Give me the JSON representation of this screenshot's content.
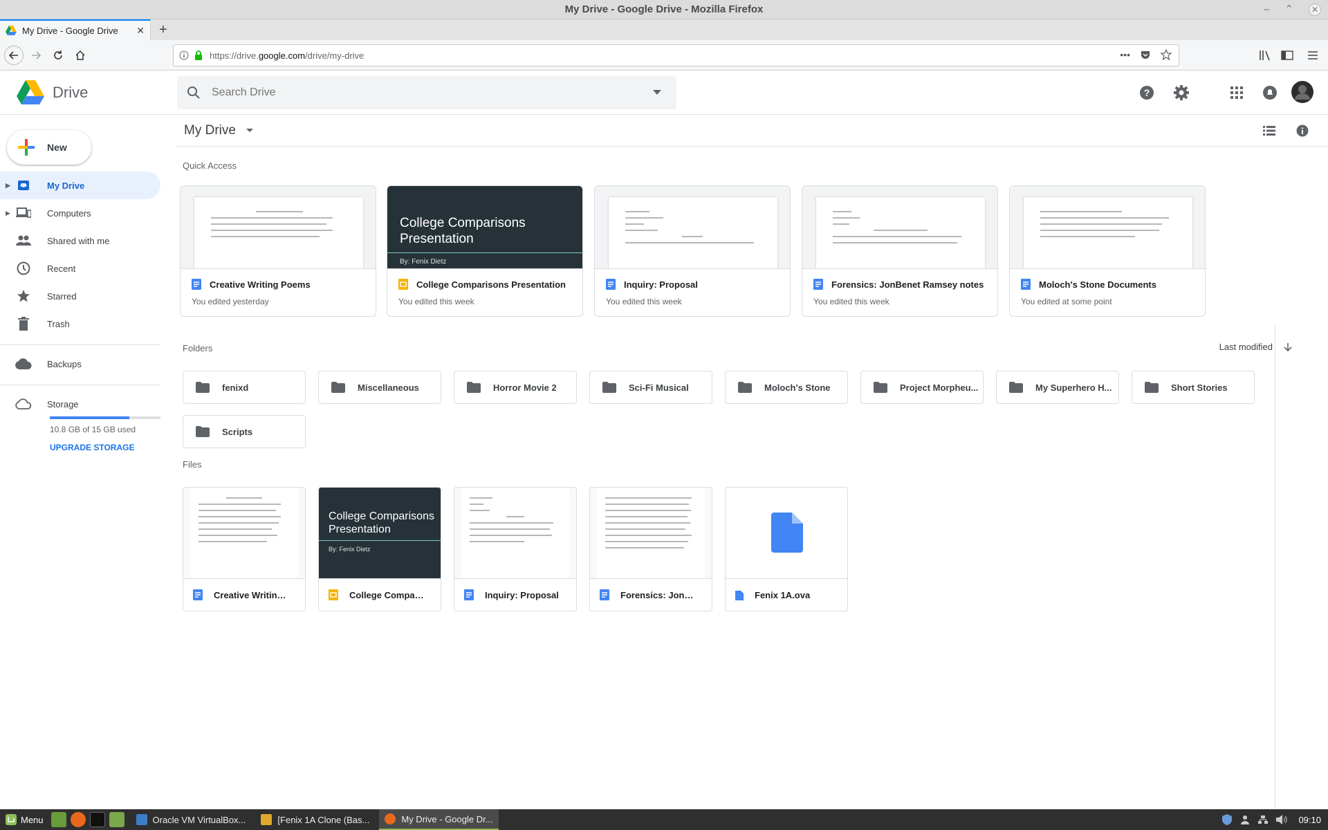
{
  "window": {
    "title": "My Drive - Google Drive - Mozilla Firefox"
  },
  "browser": {
    "tab_title": "My Drive - Google Drive",
    "url_prefix": "https://drive.",
    "url_host": "google.com",
    "url_path": "/drive/my-drive"
  },
  "drive": {
    "logo_text": "Drive",
    "search_placeholder": "Search Drive",
    "new_label": "New",
    "page_title": "My Drive"
  },
  "sidebar": {
    "items": [
      {
        "label": "My Drive",
        "icon": "my-drive-icon",
        "active": true
      },
      {
        "label": "Computers",
        "icon": "computer-icon"
      },
      {
        "label": "Shared with me",
        "icon": "people-icon"
      },
      {
        "label": "Recent",
        "icon": "clock-icon"
      },
      {
        "label": "Starred",
        "icon": "star-icon"
      },
      {
        "label": "Trash",
        "icon": "trash-icon"
      },
      {
        "label": "Backups",
        "icon": "cloud-icon"
      },
      {
        "label": "Storage",
        "icon": "cloud-outline-icon"
      }
    ],
    "storage_text": "10.8 GB of 15 GB used",
    "storage_used_fraction": 0.72,
    "upgrade_label": "UPGRADE STORAGE"
  },
  "quick_access": {
    "label": "Quick Access",
    "cards": [
      {
        "name": "Creative Writing Poems",
        "subtitle": "You edited yesterday",
        "type": "doc"
      },
      {
        "name": "College Comparisons Presentation",
        "subtitle": "You edited this week",
        "type": "slides"
      },
      {
        "name": "Inquiry: Proposal",
        "subtitle": "You edited this week",
        "type": "doc"
      },
      {
        "name": "Forensics: JonBenet Ramsey notes",
        "subtitle": "You edited this week",
        "type": "doc"
      },
      {
        "name": "Moloch's Stone Documents",
        "subtitle": "You edited at some point",
        "type": "doc"
      }
    ]
  },
  "slide_preview": {
    "title": "College Comparisons Presentation",
    "author": "By: Fenix Dietz"
  },
  "folders": {
    "label": "Folders",
    "sort_label": "Last modified",
    "items": [
      "fenixd",
      "Miscellaneous",
      "Horror Movie 2",
      "Sci-Fi Musical",
      "Moloch's Stone",
      "Project Morpheu...",
      "My Superhero H...",
      "Short Stories",
      "Scripts"
    ]
  },
  "files": {
    "label": "Files",
    "items": [
      {
        "name": "Creative Writing ...",
        "type": "doc"
      },
      {
        "name": "College Compari...",
        "type": "slides"
      },
      {
        "name": "Inquiry: Proposal",
        "type": "doc"
      },
      {
        "name": "Forensics: JonBe...",
        "type": "doc"
      },
      {
        "name": "Fenix 1A.ova",
        "type": "file"
      }
    ]
  },
  "taskbar": {
    "menu_label": "Menu",
    "tasks": [
      "Oracle VM VirtualBox...",
      "[Fenix 1A Clone (Bas...",
      "My Drive - Google Dr..."
    ],
    "clock": "09:10"
  },
  "colors": {
    "accent": "#1a73e8",
    "doc_blue": "#4285f4",
    "slides_yellow": "#f4b400",
    "folder_gray": "#5f6368"
  }
}
